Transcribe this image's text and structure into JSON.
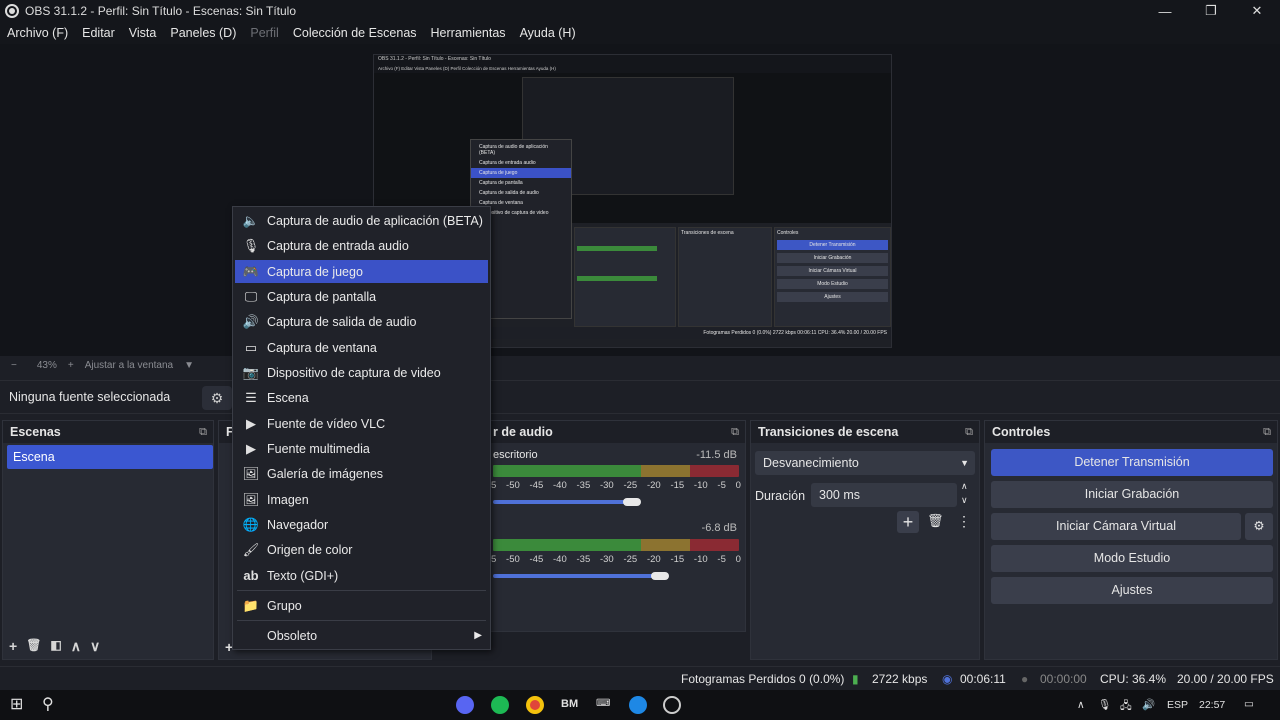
{
  "window": {
    "title": "OBS 31.1.2 - Perfil: Sin Título - Escenas: Sin Título",
    "min": "—",
    "max": "❐",
    "close": "✕"
  },
  "menubar": [
    "Archivo (F)",
    "Editar",
    "Vista",
    "Paneles (D)",
    "Perfil",
    "Colección de Escenas",
    "Herramientas",
    "Ayuda (H)"
  ],
  "zoom": {
    "minus": "−",
    "level": "43%",
    "plus": "+",
    "fit": "Ajustar a la ventana",
    "caret": "▼"
  },
  "properties": {
    "label": "Ninguna fuente seleccionada",
    "gear": "⚙"
  },
  "scenes": {
    "title": "Escenas",
    "items": [
      "Escena"
    ],
    "toolbar": [
      "+",
      "🗑",
      "◧",
      "∧",
      "∨"
    ]
  },
  "sources": {
    "title": "F",
    "add": "+"
  },
  "audio": {
    "title": "r de audio",
    "channels": [
      {
        "name": "escritorio",
        "db": "-11.5 dB",
        "level": 0.45
      },
      {
        "name": "",
        "db": "-6.8 dB",
        "level": 0.4
      }
    ],
    "scale": [
      "-50",
      "-45",
      "-40",
      "-35",
      "-30",
      "-25",
      "-20",
      "-15",
      "-10",
      "-5",
      "0"
    ],
    "scale_first": "5"
  },
  "transitions": {
    "title": "Transiciones de escena",
    "selected": "Desvanecimiento",
    "duration_label": "Duración",
    "duration_value": "300 ms",
    "add": "+",
    "remove": "🗑",
    "more": "⋮"
  },
  "controls": {
    "title": "Controles",
    "buttons": [
      "Detener Transmisión",
      "Iniciar Grabación",
      "Iniciar Cámara Virtual",
      "Modo Estudio",
      "Ajustes"
    ],
    "gear": "⚙"
  },
  "context_menu": [
    {
      "icon": "🔈",
      "label": "Captura de audio de aplicación (BETA)"
    },
    {
      "icon": "🎙",
      "label": "Captura de entrada audio"
    },
    {
      "icon": "🎮",
      "label": "Captura de juego"
    },
    {
      "icon": "🖵",
      "label": "Captura de pantalla"
    },
    {
      "icon": "🔊",
      "label": "Captura de salida de audio"
    },
    {
      "icon": "▭",
      "label": "Captura de ventana"
    },
    {
      "icon": "📷",
      "label": "Dispositivo de captura de video"
    },
    {
      "icon": "☰",
      "label": "Escena"
    },
    {
      "icon": "▶",
      "label": "Fuente de vídeo VLC"
    },
    {
      "icon": "▶",
      "label": "Fuente multimedia"
    },
    {
      "icon": "🖼",
      "label": "Galería de imágenes"
    },
    {
      "icon": "🖼",
      "label": "Imagen"
    },
    {
      "icon": "🌐",
      "label": "Navegador"
    },
    {
      "icon": "🖌",
      "label": "Origen de color"
    },
    {
      "icon": "ab",
      "label": "Texto (GDI+)"
    },
    {
      "icon": "📁",
      "label": "Grupo"
    },
    {
      "icon": "",
      "label": "Obsoleto"
    }
  ],
  "context_menu_arrow": "▶",
  "status": {
    "dropped": "Fotogramas Perdidos 0 (0.0%)",
    "kbps": "2722 kbps",
    "stream_time": "00:06:11",
    "rec_time": "00:00:00",
    "cpu": "CPU: 36.4%",
    "fps": "20.00 / 20.00 FPS"
  },
  "taskbar": {
    "start": "⊞",
    "search": "⚲",
    "apps": [
      "BM"
    ],
    "lang": "ESP",
    "time": "22:57",
    "tray": "∧"
  },
  "preview": {
    "title": "OBS 31.1.2 - Perfil: Sin Título - Escenas: Sin Título",
    "menu": "Archivo (F)  Editar  Vista  Paneles (D)  Perfil  Colección de Escenas  Herramientas  Ayuda (H)",
    "items": [
      "Captura de audio de aplicación (BETA)",
      "Captura de entrada audio",
      "Captura de juego",
      "Captura de pantalla",
      "Captura de salida de audio",
      "Captura de ventana",
      "Dispositivo de captura de video"
    ],
    "trans": "Transiciones de escena",
    "ctrl": "Controles",
    "ctrl_buttons": [
      "Detener Transmisión",
      "Iniciar Grabación",
      "Iniciar Cámara Virtual",
      "Modo Estudio",
      "Ajustes"
    ],
    "status": "Fotogramas Perdidos 0 (0.0%)   2722 kbps   00:06:11   CPU: 36.4%   20.00 / 20.00 FPS"
  }
}
